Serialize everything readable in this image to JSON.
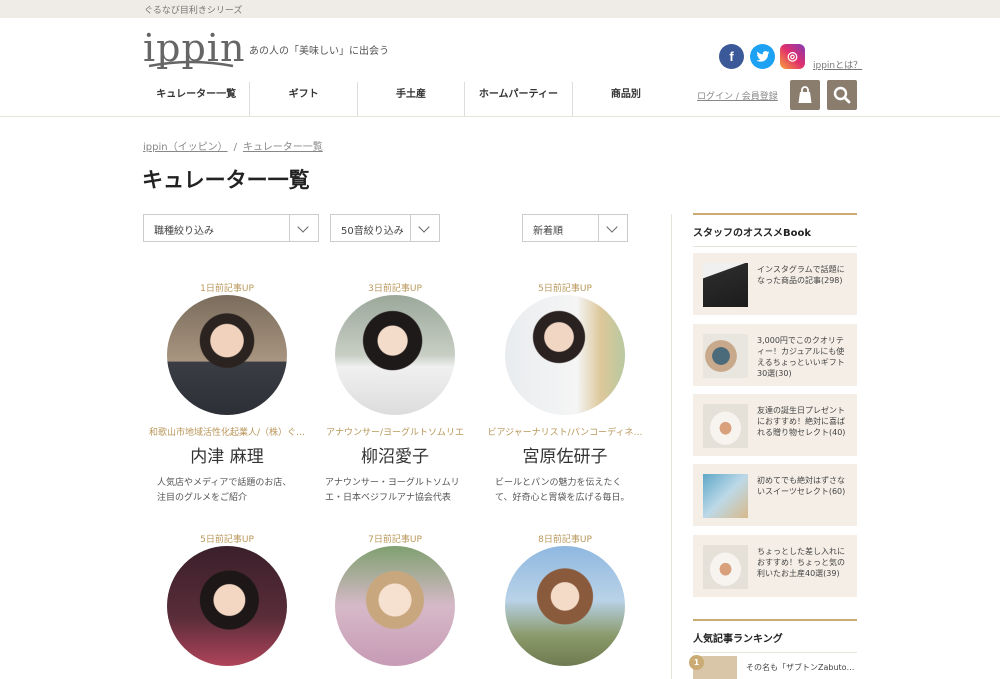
{
  "topbar": {
    "series_label": "ぐるなび目利きシリーズ"
  },
  "header": {
    "logo_text": "ippin",
    "tagline": "あの人の「美味しい」に出会う",
    "social": {
      "facebook": "f",
      "twitter": "t",
      "instagram": "◎"
    },
    "about_link": "ippinとは？",
    "login_link": "ログイン / 会員登録",
    "nav": [
      "キュレーター一覧",
      "ギフト",
      "手土産",
      "ホームパーティー",
      "商品別"
    ],
    "colors": {
      "accent": "#b8975a",
      "button": "#8a7d6e"
    }
  },
  "breadcrumb": [
    "ippin（イッピン）",
    "キュレーター一覧"
  ],
  "page_title": "キュレーター一覧",
  "filters": {
    "occupation": "職種絞り込み",
    "kana": "50音絞り込み",
    "sort": "新着順"
  },
  "curators": [
    {
      "updated": "1日前記事UP",
      "role": "和歌山市地域活性化起業人/（株）ぐ…",
      "name": "内津 麻理",
      "desc": "人気店やメディアで話題のお店、注目のグルメをご紹介"
    },
    {
      "updated": "3日前記事UP",
      "role": "アナウンサー/ヨーグルトソムリエ",
      "name": "柳沼愛子",
      "desc": "アナウンサー・ヨーグルトソムリエ・日本ベジフルアナ協会代表"
    },
    {
      "updated": "5日前記事UP",
      "role": "ビアジャーナリスト/パンコーディネ…",
      "name": "宮原佐研子",
      "desc": "ビールとパンの魅力を伝えたくて、好奇心と胃袋を広げる毎日。"
    },
    {
      "updated": "5日前記事UP",
      "role": "",
      "name": "",
      "desc": ""
    },
    {
      "updated": "7日前記事UP",
      "role": "",
      "name": "",
      "desc": ""
    },
    {
      "updated": "8日前記事UP",
      "role": "",
      "name": "",
      "desc": ""
    }
  ],
  "sidebar": {
    "staff_books_title": "スタッフのオススメBook",
    "books": [
      "インスタグラムで話題になった商品の記事(298)",
      "3,000円でこのクオリティー！カジュアルにも使えるちょっといいギフト30選(30)",
      "友達の誕生日プレゼントにおすすめ！絶対に喜ばれる贈り物セレクト(40)",
      "初めてでも絶対はずさないスイーツセレクト(60)",
      "ちょっとした差し入れにおすすめ！ちょっと気の利いたお土産40選(39)"
    ],
    "ranking_title": "人気記事ランキング",
    "ranking": [
      {
        "rank": "1",
        "text": "その名も「ザブトンZabuto…"
      }
    ]
  }
}
